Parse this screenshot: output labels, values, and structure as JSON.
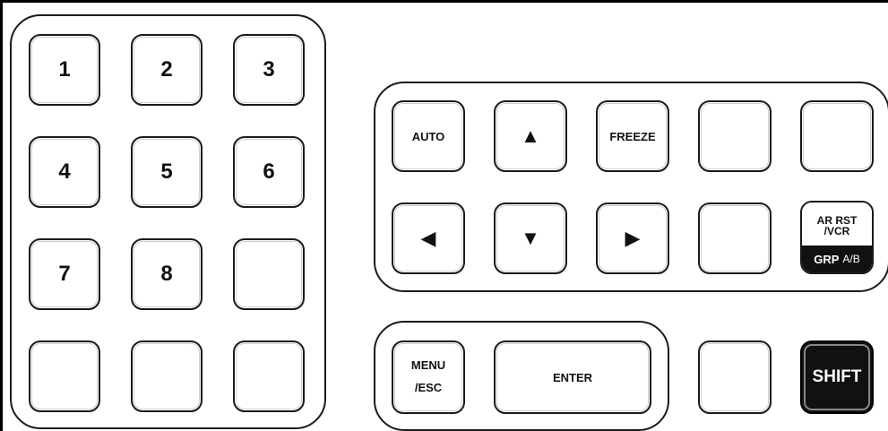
{
  "numpad": {
    "k1": "1",
    "k2": "2",
    "k3": "3",
    "k4": "4",
    "k5": "5",
    "k6": "6",
    "k7": "7",
    "k8": "8"
  },
  "control": {
    "auto": "AUTO",
    "up": "▲",
    "freeze": "FREEZE",
    "left": "◀",
    "down": "▼",
    "right": "▶",
    "ar_rst_line1": "AR RST",
    "ar_rst_line2": "/VCR",
    "grp": "GRP",
    "ab": "A/B"
  },
  "menu": {
    "menu_line1": "MENU",
    "menu_line2": "/ESC",
    "enter": "ENTER"
  },
  "shift": "SHIFT"
}
